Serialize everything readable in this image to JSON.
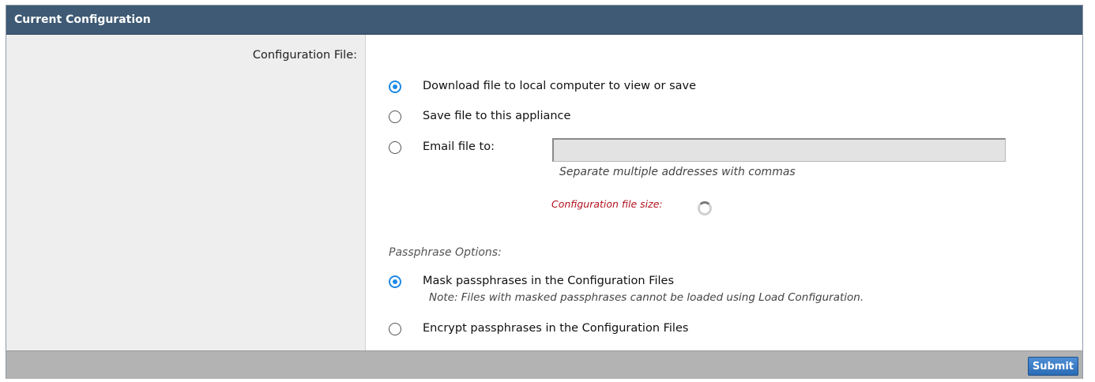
{
  "panel": {
    "title": "Current Configuration"
  },
  "config_file": {
    "label": "Configuration File:",
    "options": [
      {
        "label": "Download file to local computer to view or save",
        "checked": true
      },
      {
        "label": "Save file to this appliance",
        "checked": false
      },
      {
        "label": "Email file to:",
        "checked": false
      }
    ],
    "email_input": {
      "value": "",
      "placeholder": ""
    },
    "email_hint": "Separate multiple addresses with commas",
    "size_label": "Configuration file size:"
  },
  "passphrase": {
    "section_label": "Passphrase Options:",
    "options": [
      {
        "label": "Mask passphrases in the Configuration Files",
        "note": "Note: Files with masked passphrases cannot be loaded using Load Configuration.",
        "checked": true
      },
      {
        "label": "Encrypt passphrases in the Configuration Files",
        "checked": false
      }
    ]
  },
  "footer": {
    "submit_label": "Submit"
  },
  "colors": {
    "header_bg": "#3e5a74",
    "radio_accent": "#1e88e5",
    "size_label_color": "#b3121e",
    "footer_bg": "#b3b3b3",
    "submit_bg": "#2b6cb6"
  },
  "icons": {
    "loading": "spinner-icon"
  }
}
